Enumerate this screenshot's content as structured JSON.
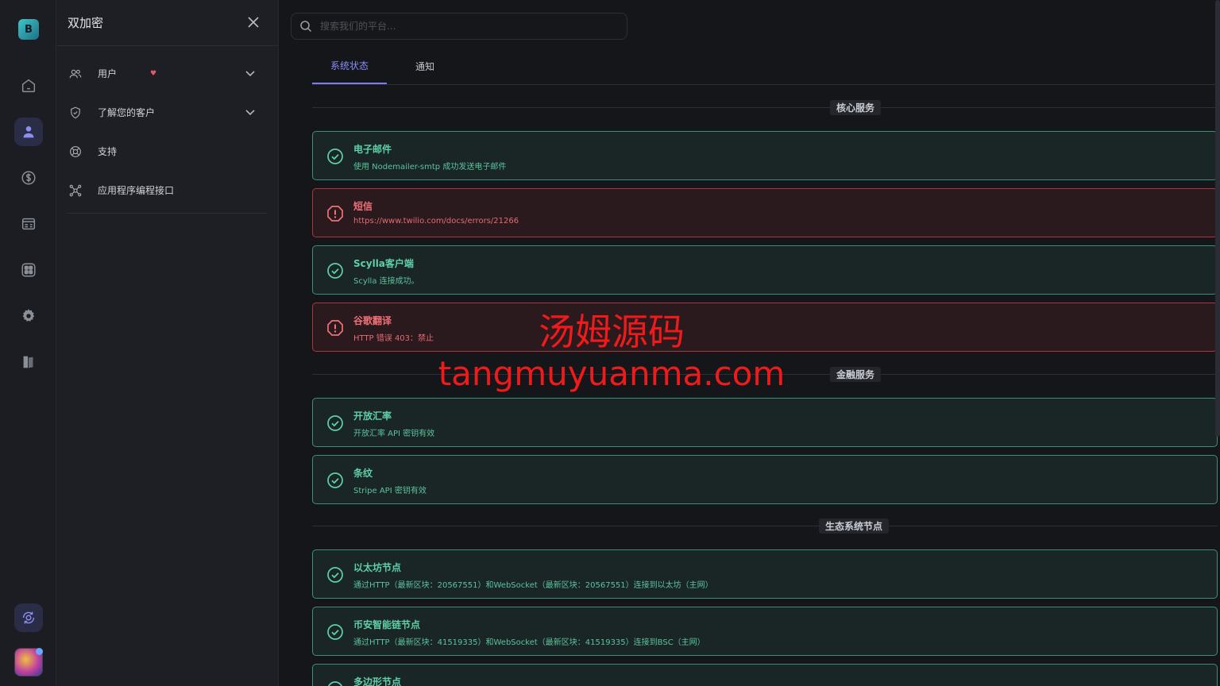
{
  "colors": {
    "accent": "#7b7cf0",
    "success": "#5fcfa8",
    "error": "#f07078"
  },
  "rail": {
    "logo_letter": "B",
    "items": [
      {
        "name": "home-icon"
      },
      {
        "name": "user-icon",
        "active": true
      },
      {
        "name": "dollar-icon"
      },
      {
        "name": "ledger-icon"
      },
      {
        "name": "apps-icon"
      },
      {
        "name": "gear-icon"
      },
      {
        "name": "book-icon"
      }
    ]
  },
  "panel": {
    "title": "双加密",
    "items": [
      {
        "label": "用户",
        "icon": "users-icon",
        "badge": "♥",
        "expandable": true
      },
      {
        "label": "了解您的客户",
        "icon": "shield-check-icon",
        "expandable": true
      },
      {
        "label": "支持",
        "icon": "lifebuoy-icon"
      },
      {
        "label": "应用程序编程接口",
        "icon": "api-nodes-icon"
      }
    ]
  },
  "search": {
    "placeholder": "搜索我们的平台..."
  },
  "tabs": [
    {
      "label": "系统状态",
      "active": true
    },
    {
      "label": "通知"
    }
  ],
  "sections": [
    {
      "label": "核心服务",
      "cards": [
        {
          "status": "ok",
          "title": "电子邮件",
          "desc": "使用 Nodemailer-smtp 成功发送电子邮件"
        },
        {
          "status": "error",
          "title": "短信",
          "desc": "https://www.twilio.com/docs/errors/21266"
        },
        {
          "status": "ok",
          "title": "Scylla客户端",
          "desc": "Scylla 连接成功。"
        },
        {
          "status": "error",
          "title": "谷歌翻译",
          "desc": "HTTP 错误 403：禁止"
        }
      ]
    },
    {
      "label": "金融服务",
      "cards": [
        {
          "status": "ok",
          "title": "开放汇率",
          "desc": "开放汇率 API 密钥有效"
        },
        {
          "status": "ok",
          "title": "条纹",
          "desc": "Stripe API 密钥有效"
        }
      ]
    },
    {
      "label": "生态系统节点",
      "cards": [
        {
          "status": "ok",
          "title": "以太坊节点",
          "desc": "通过HTTP（最新区块：20567551）和WebSocket（最新区块：20567551）连接到以太坊（主网）"
        },
        {
          "status": "ok",
          "title": "币安智能链节点",
          "desc": "通过HTTP（最新区块：41519335）和WebSocket（最新区块：41519335）连接到BSC（主网）"
        },
        {
          "status": "ok",
          "title": "多边形节点",
          "desc": ""
        }
      ]
    }
  ],
  "watermark": {
    "line1": "汤姆源码",
    "line2": "tangmuyuanma.com"
  }
}
